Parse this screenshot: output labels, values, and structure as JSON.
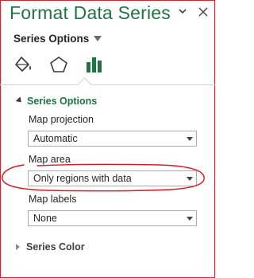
{
  "pane": {
    "title": "Format Data Series"
  },
  "series_dropdown": {
    "label": "Series Options"
  },
  "tabs": [
    {
      "name": "fill-line",
      "icon": "paint-bucket-icon"
    },
    {
      "name": "effects",
      "icon": "pentagon-icon"
    },
    {
      "name": "series-options",
      "icon": "bar-chart-icon",
      "active": true
    }
  ],
  "series_options": {
    "heading": "Series Options",
    "map_projection": {
      "label": "Map projection",
      "value": "Automatic"
    },
    "map_area": {
      "label": "Map area",
      "value": "Only regions with data"
    },
    "map_labels": {
      "label": "Map labels",
      "value": "None"
    }
  },
  "series_color": {
    "heading": "Series Color"
  },
  "colors": {
    "accent": "#217346",
    "annotation": "#e0141e",
    "frame": "#d9232e"
  }
}
